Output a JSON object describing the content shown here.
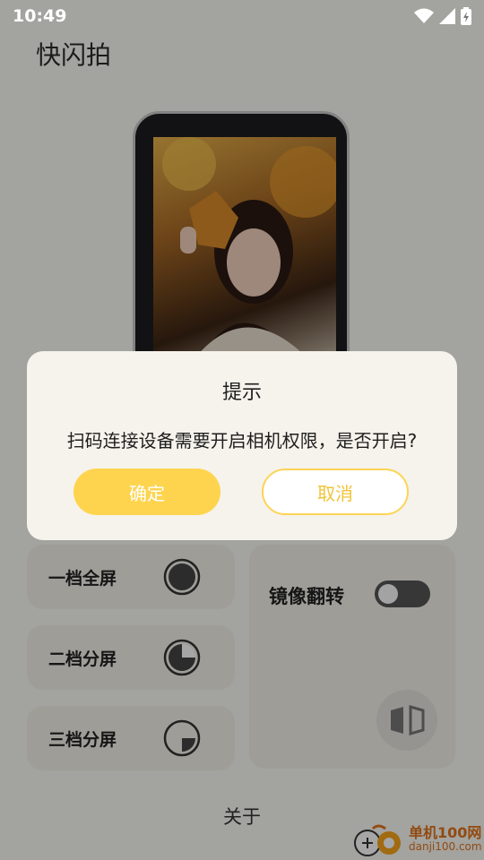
{
  "status_bar": {
    "time": "10:49"
  },
  "app": {
    "title": "快闪拍"
  },
  "modes": [
    {
      "label": "一档全屏",
      "icon": "full-circle-icon"
    },
    {
      "label": "二档分屏",
      "icon": "half-circle-icon"
    },
    {
      "label": "三档分屏",
      "icon": "quarter-circle-icon"
    }
  ],
  "mirror": {
    "label": "镜像翻转",
    "enabled": false,
    "icon": "mirror-flip-icon"
  },
  "footer": {
    "about": "关于"
  },
  "watermark": {
    "brand": "单机100网",
    "url": "danji100.com"
  },
  "dialog": {
    "title": "提示",
    "message": "扫码连接设备需要开启相机权限，是否开启?",
    "confirm": "确定",
    "cancel": "取消"
  },
  "colors": {
    "accent": "#fed44f",
    "overlay": "rgba(0,0,0,0.35)"
  }
}
